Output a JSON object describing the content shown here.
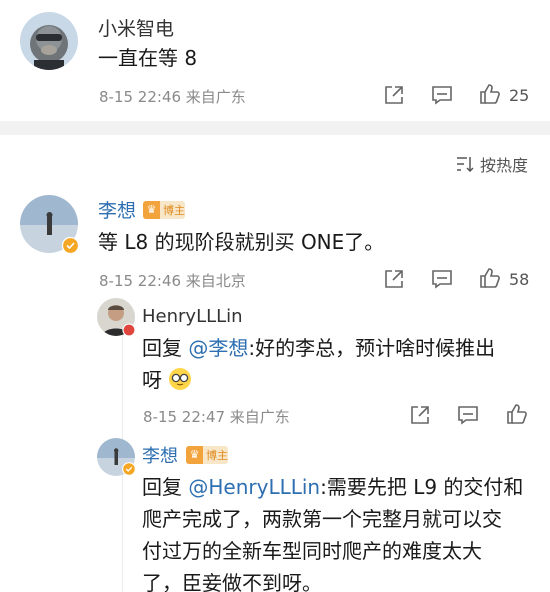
{
  "post": {
    "author": "小米智电",
    "text": "一直在等 8",
    "meta": "8-15 22:46 来自广东",
    "like_count": "25",
    "icons": [
      "share-icon",
      "comment-icon",
      "like-icon"
    ]
  },
  "sort": {
    "label": "按热度",
    "icon": "sort-icon"
  },
  "comment": {
    "author": "李想",
    "badge": "博主",
    "text": "等 L8 的现阶段就别买 ONE了。",
    "meta": "8-15 22:46 来自北京",
    "like_count": "58"
  },
  "replies": [
    {
      "author": "HenryLLLin",
      "prefix": "回复 ",
      "mention": "@李想",
      "line1": ":好的李总，预计啥时候推出",
      "line2": "呀",
      "emoji": "glasses-emoji",
      "meta": "8-15 22:47 来自广东"
    },
    {
      "author": "李想",
      "badge": "博主",
      "prefix": "回复 ",
      "mention": "@HenryLLLin",
      "line1": ":需要先把 L9 的交付和",
      "line2": "爬产完成了，两款第一个完整月就可以交",
      "line3": "付过万的全新车型同时爬产的难度太大",
      "line4": "了，臣妾做不到呀。"
    }
  ]
}
